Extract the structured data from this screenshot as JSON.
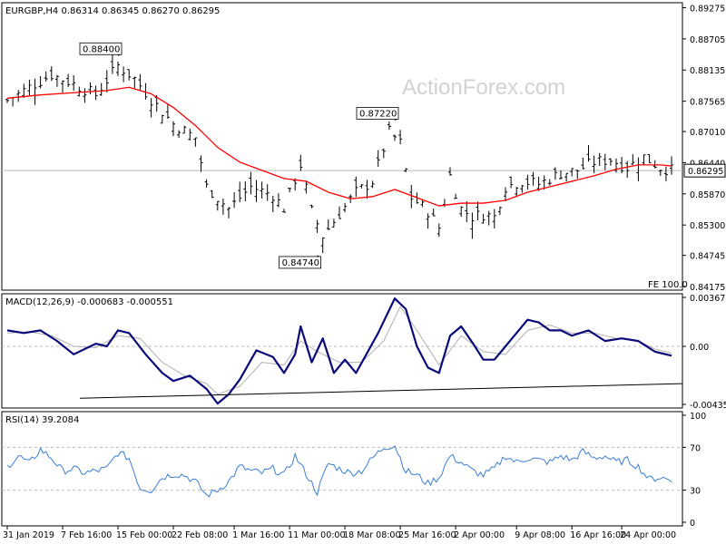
{
  "chart_data": [
    {
      "type": "candlestick",
      "title": "EURGBP,H4",
      "ohlc": "0.86314 0.86345 0.86270 0.86295",
      "watermark": "ActionForex.com",
      "ylim": [
        0.84175,
        0.893
      ],
      "yticks": [
        "0.89275",
        "0.88705",
        "0.88135",
        "0.87565",
        "0.87010",
        "0.86440",
        "0.85870",
        "0.85300",
        "0.84745",
        "0.84175"
      ],
      "last_price": "0.86295",
      "last_price_value": 0.86295,
      "fe_label": "FE 100.0",
      "annotations": [
        {
          "text": "0.88400",
          "value": 0.884,
          "bar": 20
        },
        {
          "text": "0.87220",
          "value": 0.8722,
          "bar": 70
        },
        {
          "text": "0.84740",
          "value": 0.8474,
          "bar": 56
        }
      ],
      "close_path": [
        [
          0,
          0.8758
        ],
        [
          4,
          0.8782
        ],
        [
          8,
          0.8805
        ],
        [
          12,
          0.8788
        ],
        [
          16,
          0.8768
        ],
        [
          20,
          0.8822
        ],
        [
          23,
          0.8798
        ],
        [
          26,
          0.876
        ],
        [
          30,
          0.8715
        ],
        [
          34,
          0.869
        ],
        [
          36,
          0.86
        ],
        [
          40,
          0.856
        ],
        [
          44,
          0.86
        ],
        [
          48,
          0.8585
        ],
        [
          50,
          0.856
        ],
        [
          53,
          0.864
        ],
        [
          55,
          0.8555
        ],
        [
          57,
          0.851
        ],
        [
          60,
          0.855
        ],
        [
          63,
          0.859
        ],
        [
          66,
          0.861
        ],
        [
          69,
          0.87
        ],
        [
          71,
          0.868
        ],
        [
          73,
          0.858
        ],
        [
          76,
          0.8555
        ],
        [
          78,
          0.8525
        ],
        [
          80,
          0.862
        ],
        [
          82,
          0.856
        ],
        [
          84,
          0.8545
        ],
        [
          86,
          0.855
        ],
        [
          88,
          0.8545
        ],
        [
          90,
          0.86
        ],
        [
          93,
          0.861
        ],
        [
          96,
          0.8605
        ],
        [
          100,
          0.8625
        ],
        [
          103,
          0.863
        ],
        [
          106,
          0.8645
        ],
        [
          109,
          0.865
        ],
        [
          112,
          0.8635
        ],
        [
          115,
          0.8655
        ],
        [
          118,
          0.8635
        ],
        [
          120,
          0.863
        ]
      ],
      "ma_path": [
        [
          0,
          0.8762
        ],
        [
          6,
          0.8768
        ],
        [
          12,
          0.8772
        ],
        [
          18,
          0.8776
        ],
        [
          22,
          0.8782
        ],
        [
          26,
          0.877
        ],
        [
          30,
          0.8745
        ],
        [
          34,
          0.8712
        ],
        [
          38,
          0.8672
        ],
        [
          42,
          0.8645
        ],
        [
          46,
          0.863
        ],
        [
          50,
          0.8615
        ],
        [
          54,
          0.861
        ],
        [
          58,
          0.859
        ],
        [
          62,
          0.8578
        ],
        [
          66,
          0.8582
        ],
        [
          70,
          0.8595
        ],
        [
          74,
          0.858
        ],
        [
          78,
          0.8565
        ],
        [
          82,
          0.857
        ],
        [
          86,
          0.857
        ],
        [
          90,
          0.8575
        ],
        [
          94,
          0.859
        ],
        [
          98,
          0.86
        ],
        [
          102,
          0.861
        ],
        [
          106,
          0.862
        ],
        [
          110,
          0.8632
        ],
        [
          114,
          0.864
        ],
        [
          118,
          0.864
        ],
        [
          120,
          0.8638
        ]
      ]
    },
    {
      "type": "line",
      "title": "MACD(12,26,9) -0.000683 -0.000551",
      "ylim": [
        -0.004359,
        0.003678
      ],
      "yticks": [
        "0.003678",
        "0.00",
        "-0.004359"
      ],
      "macd_path": [
        [
          0,
          0.0012
        ],
        [
          3,
          0.001
        ],
        [
          6,
          0.0012
        ],
        [
          9,
          0.0004
        ],
        [
          12,
          -0.0006
        ],
        [
          16,
          0.0002
        ],
        [
          18,
          0.0
        ],
        [
          20,
          0.0012
        ],
        [
          22,
          0.001
        ],
        [
          25,
          -0.0006
        ],
        [
          28,
          -0.002
        ],
        [
          30,
          -0.0026
        ],
        [
          33,
          -0.0022
        ],
        [
          36,
          -0.0032
        ],
        [
          38,
          -0.0043
        ],
        [
          40,
          -0.0036
        ],
        [
          42,
          -0.0025
        ],
        [
          45,
          -0.0003
        ],
        [
          48,
          -0.0008
        ],
        [
          50,
          -0.002
        ],
        [
          52,
          -0.0006
        ],
        [
          53,
          0.0015
        ],
        [
          55,
          -0.0012
        ],
        [
          57,
          0.0006
        ],
        [
          59,
          -0.002
        ],
        [
          61,
          -0.001
        ],
        [
          63,
          -0.002
        ],
        [
          65,
          -0.0005
        ],
        [
          67,
          0.001
        ],
        [
          70,
          0.0036
        ],
        [
          72,
          0.0028
        ],
        [
          74,
          0.0
        ],
        [
          76,
          -0.0016
        ],
        [
          78,
          -0.002
        ],
        [
          80,
          0.0008
        ],
        [
          82,
          0.0015
        ],
        [
          84,
          0.0003
        ],
        [
          86,
          -0.001
        ],
        [
          88,
          -0.001
        ],
        [
          90,
          0.0
        ],
        [
          92,
          0.001
        ],
        [
          94,
          0.002
        ],
        [
          96,
          0.0018
        ],
        [
          98,
          0.0012
        ],
        [
          100,
          0.0012
        ],
        [
          102,
          0.0008
        ],
        [
          105,
          0.0012
        ],
        [
          108,
          0.0004
        ],
        [
          111,
          0.0006
        ],
        [
          114,
          0.0004
        ],
        [
          117,
          -0.0004
        ],
        [
          120,
          -0.0007
        ]
      ],
      "signal_path": [
        [
          0,
          0.001
        ],
        [
          4,
          0.0011
        ],
        [
          8,
          0.0008
        ],
        [
          12,
          0.0
        ],
        [
          16,
          -0.0001
        ],
        [
          20,
          0.0008
        ],
        [
          24,
          0.0006
        ],
        [
          28,
          -0.0012
        ],
        [
          32,
          -0.0022
        ],
        [
          36,
          -0.0028
        ],
        [
          38,
          -0.0036
        ],
        [
          42,
          -0.003
        ],
        [
          46,
          -0.0012
        ],
        [
          50,
          -0.0014
        ],
        [
          53,
          0.0004
        ],
        [
          56,
          -0.0004
        ],
        [
          60,
          -0.0012
        ],
        [
          64,
          -0.0012
        ],
        [
          68,
          0.0004
        ],
        [
          71,
          0.003
        ],
        [
          74,
          0.0012
        ],
        [
          78,
          -0.0014
        ],
        [
          82,
          0.0008
        ],
        [
          86,
          -0.0004
        ],
        [
          90,
          -0.0006
        ],
        [
          94,
          0.0012
        ],
        [
          98,
          0.0016
        ],
        [
          102,
          0.001
        ],
        [
          106,
          0.001
        ],
        [
          110,
          0.0006
        ],
        [
          114,
          0.0004
        ],
        [
          117,
          -0.0002
        ],
        [
          120,
          -0.0005
        ]
      ],
      "trendline": [
        [
          0,
          -0.0041
        ],
        [
          120,
          -0.0028
        ]
      ]
    },
    {
      "type": "line",
      "title": "RSI(14) 39.2084",
      "ylim": [
        0,
        100
      ],
      "yticks": [
        "100",
        "70",
        "30",
        "0"
      ],
      "levels": [
        70,
        30
      ],
      "rsi_path": [
        [
          0,
          52
        ],
        [
          2,
          62
        ],
        [
          4,
          55
        ],
        [
          6,
          68
        ],
        [
          8,
          60
        ],
        [
          10,
          48
        ],
        [
          12,
          50
        ],
        [
          14,
          46
        ],
        [
          16,
          48
        ],
        [
          18,
          50
        ],
        [
          20,
          65
        ],
        [
          22,
          60
        ],
        [
          24,
          32
        ],
        [
          26,
          30
        ],
        [
          28,
          42
        ],
        [
          30,
          45
        ],
        [
          32,
          44
        ],
        [
          34,
          38
        ],
        [
          36,
          25
        ],
        [
          38,
          30
        ],
        [
          40,
          38
        ],
        [
          42,
          52
        ],
        [
          44,
          48
        ],
        [
          46,
          46
        ],
        [
          48,
          50
        ],
        [
          50,
          44
        ],
        [
          52,
          62
        ],
        [
          54,
          45
        ],
        [
          56,
          28
        ],
        [
          58,
          55
        ],
        [
          60,
          50
        ],
        [
          62,
          46
        ],
        [
          64,
          48
        ],
        [
          66,
          60
        ],
        [
          68,
          70
        ],
        [
          70,
          72
        ],
        [
          72,
          48
        ],
        [
          74,
          44
        ],
        [
          76,
          36
        ],
        [
          78,
          42
        ],
        [
          80,
          62
        ],
        [
          82,
          56
        ],
        [
          84,
          48
        ],
        [
          86,
          44
        ],
        [
          88,
          50
        ],
        [
          90,
          62
        ],
        [
          92,
          56
        ],
        [
          94,
          60
        ],
        [
          96,
          58
        ],
        [
          98,
          56
        ],
        [
          100,
          62
        ],
        [
          102,
          58
        ],
        [
          104,
          66
        ],
        [
          106,
          60
        ],
        [
          108,
          62
        ],
        [
          110,
          56
        ],
        [
          112,
          58
        ],
        [
          114,
          52
        ],
        [
          116,
          40
        ],
        [
          118,
          42
        ],
        [
          120,
          39
        ]
      ]
    }
  ],
  "x_axis": {
    "bars": 120,
    "labels": [
      {
        "text": "31 Jan 2019",
        "bar": 0
      },
      {
        "text": "7 Feb 16:00",
        "bar": 10
      },
      {
        "text": "15 Feb 00:00",
        "bar": 20
      },
      {
        "text": "22 Feb 08:00",
        "bar": 30
      },
      {
        "text": "1 Mar 16:00",
        "bar": 41
      },
      {
        "text": "11 Mar 00:00",
        "bar": 51
      },
      {
        "text": "18 Mar 08:00",
        "bar": 61
      },
      {
        "text": "25 Mar 16:00",
        "bar": 71
      },
      {
        "text": "2 Apr 00:00",
        "bar": 81
      },
      {
        "text": "9 Apr 08:00",
        "bar": 92
      },
      {
        "text": "16 Apr 16:00",
        "bar": 102
      },
      {
        "text": "24 Apr 00:00",
        "bar": 111
      }
    ]
  },
  "colors": {
    "candles": "#000000",
    "ma": "#ff0000",
    "macd": "#0a0a7a",
    "signal": "#b0b0b0",
    "rsi": "#3a7fd6",
    "grid": "#bbbbbb"
  }
}
